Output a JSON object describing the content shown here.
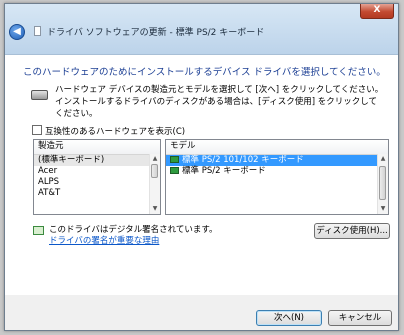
{
  "window": {
    "title": "ドライバ ソフトウェアの更新 - 標準 PS/2 キーボード",
    "close_label": "X"
  },
  "content": {
    "heading": "このハードウェアのためにインストールするデバイス ドライバを選択してください。",
    "description": "ハードウェア デバイスの製造元とモデルを選択して [次へ] をクリックしてください。インストールするドライバのディスクがある場合は、[ディスク使用] をクリックしてください。",
    "compat_label": "互換性のあるハードウェアを表示(C)",
    "manufacturer": {
      "header": "製造元",
      "items": [
        "(標準キーボード)",
        "Acer",
        "ALPS",
        "AT&T"
      ]
    },
    "model": {
      "header": "モデル",
      "items": [
        "標準 PS/2 101/102 キーボード",
        "標準 PS/2 キーボード"
      ]
    },
    "signed_text": "このドライバはデジタル署名されています。",
    "signing_link": "ドライバの署名が重要な理由",
    "disk_button": "ディスク使用(H)..."
  },
  "footer": {
    "next_button": "次へ(N)",
    "cancel_button": "キャンセル"
  }
}
